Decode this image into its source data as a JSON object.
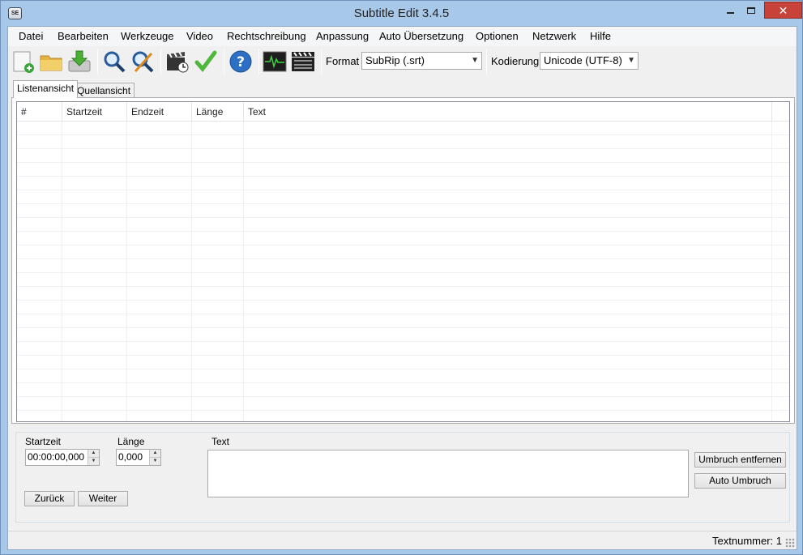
{
  "window": {
    "title": "Subtitle Edit 3.4.5",
    "app_icon_text": "SE"
  },
  "menu": [
    "Datei",
    "Bearbeiten",
    "Werkzeuge",
    "Video",
    "Rechtschreibung",
    "Anpassung",
    "Auto Übersetzung",
    "Optionen",
    "Netzwerk",
    "Hilfe"
  ],
  "toolbar": {
    "icons": [
      "new-file-icon",
      "open-folder-icon",
      "download-icon",
      "find-icon",
      "replace-icon",
      "visual-sync-icon",
      "spell-check-icon",
      "help-icon",
      "waveform-icon",
      "video-icon"
    ],
    "format_label": "Format",
    "format_value": "SubRip (.srt)",
    "encoding_label": "Kodierung",
    "encoding_value": "Unicode (UTF-8)"
  },
  "tabs": {
    "list_view": "Listenansicht",
    "source_view": "Quellansicht"
  },
  "grid": {
    "columns": [
      "#",
      "Startzeit",
      "Endzeit",
      "Länge",
      "Text"
    ],
    "rows": []
  },
  "editor": {
    "start_label": "Startzeit",
    "start_value": "00:00:00,000",
    "duration_label": "Länge",
    "duration_value": "0,000",
    "text_label": "Text",
    "prev_button": "Zurück",
    "next_button": "Weiter",
    "remove_break_button": "Umbruch entfernen",
    "auto_break_button": "Auto Umbruch"
  },
  "status": {
    "text": "Textnummer: 1"
  }
}
